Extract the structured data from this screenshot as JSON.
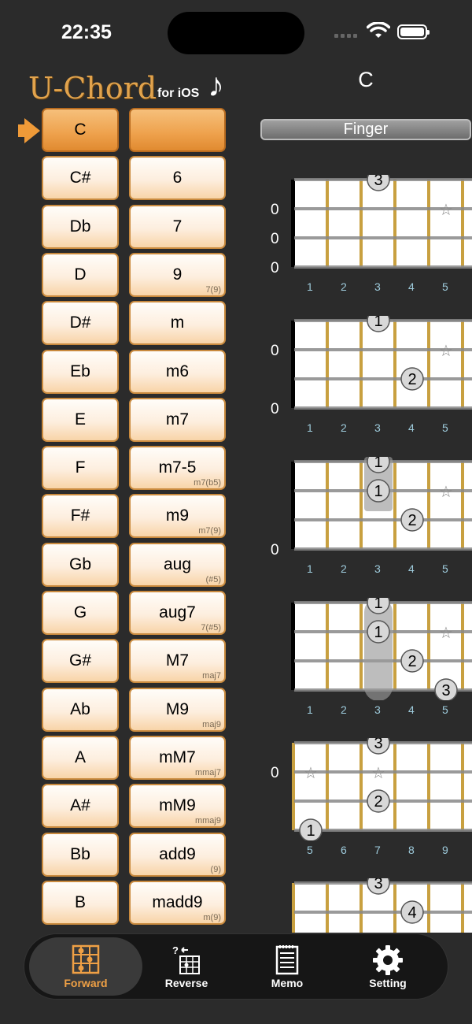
{
  "status": {
    "time": "22:35"
  },
  "logo": {
    "main": "U-Chord",
    "sub": "for iOS",
    "note": "♪"
  },
  "chord_title": "C",
  "finger_button": "Finger",
  "roots": [
    "C",
    "C#",
    "Db",
    "D",
    "D#",
    "Eb",
    "E",
    "F",
    "F#",
    "Gb",
    "G",
    "G#",
    "Ab",
    "A",
    "A#",
    "Bb",
    "B"
  ],
  "types": [
    {
      "label": "",
      "sub": ""
    },
    {
      "label": "6",
      "sub": ""
    },
    {
      "label": "7",
      "sub": ""
    },
    {
      "label": "9",
      "sub": "7(9)"
    },
    {
      "label": "m",
      "sub": ""
    },
    {
      "label": "m6",
      "sub": ""
    },
    {
      "label": "m7",
      "sub": ""
    },
    {
      "label": "m7-5",
      "sub": "m7(b5)"
    },
    {
      "label": "m9",
      "sub": "m7(9)"
    },
    {
      "label": "aug",
      "sub": "(#5)"
    },
    {
      "label": "aug7",
      "sub": "7(#5)"
    },
    {
      "label": "M7",
      "sub": "maj7"
    },
    {
      "label": "M9",
      "sub": "maj9"
    },
    {
      "label": "mM7",
      "sub": "mmaj7"
    },
    {
      "label": "mM9",
      "sub": "mmaj9"
    },
    {
      "label": "add9",
      "sub": "(9)"
    },
    {
      "label": "madd9",
      "sub": "m(9)"
    }
  ],
  "diagrams": [
    {
      "frets": [
        "1",
        "2",
        "3",
        "4",
        "5"
      ],
      "open": [
        "0",
        "0",
        "0"
      ],
      "barre": false,
      "dots": [
        {
          "s": 0,
          "f": 3,
          "label": "3"
        },
        {
          "s": 1,
          "f": 5,
          "label": "☆",
          "star": true
        }
      ]
    },
    {
      "frets": [
        "1",
        "2",
        "3",
        "4",
        "5"
      ],
      "open": [
        "0",
        "",
        "0"
      ],
      "barre": false,
      "dots": [
        {
          "s": 0,
          "f": 3,
          "label": "1"
        },
        {
          "s": 1,
          "f": 5,
          "label": "☆",
          "star": true
        },
        {
          "s": 2,
          "f": 4,
          "label": "2"
        }
      ]
    },
    {
      "frets": [
        "1",
        "2",
        "3",
        "4",
        "5"
      ],
      "open": [
        "",
        "",
        "0"
      ],
      "barre": true,
      "barre_fret": 3,
      "dots": [
        {
          "s": 0,
          "f": 3,
          "label": "1"
        },
        {
          "s": 1,
          "f": 3,
          "label": "1"
        },
        {
          "s": 1,
          "f": 5,
          "label": "☆",
          "star": true
        },
        {
          "s": 2,
          "f": 4,
          "label": "2"
        }
      ]
    },
    {
      "frets": [
        "1",
        "2",
        "3",
        "4",
        "5"
      ],
      "open": [
        "",
        "",
        ""
      ],
      "barre": true,
      "barre_fret": 3,
      "dots": [
        {
          "s": 0,
          "f": 3,
          "label": "1"
        },
        {
          "s": 1,
          "f": 3,
          "label": "1"
        },
        {
          "s": 1,
          "f": 5,
          "label": "☆",
          "star": true
        },
        {
          "s": 2,
          "f": 4,
          "label": "2"
        },
        {
          "s": 3,
          "f": 5,
          "label": "3"
        }
      ]
    },
    {
      "frets": [
        "5",
        "6",
        "7",
        "8",
        "9"
      ],
      "open": [
        "0",
        "",
        ""
      ],
      "barre": false,
      "dots": [
        {
          "s": 0,
          "f": 3,
          "label": "3"
        },
        {
          "s": 1,
          "f": 1,
          "label": "☆",
          "star": true
        },
        {
          "s": 1,
          "f": 3,
          "label": "☆",
          "star": true
        },
        {
          "s": 2,
          "f": 3,
          "label": "2"
        },
        {
          "s": 3,
          "f": 1,
          "label": "1"
        }
      ]
    },
    {
      "frets": [
        "",
        "",
        "",
        "",
        ""
      ],
      "open": [
        "",
        "",
        ""
      ],
      "barre": false,
      "dots": [
        {
          "s": 0,
          "f": 3,
          "label": "3"
        },
        {
          "s": 1,
          "f": 4,
          "label": "4"
        },
        {
          "s": 2,
          "f": 1,
          "label": "☆",
          "star": true
        },
        {
          "s": 2,
          "f": 3,
          "label": "☆",
          "star": true
        }
      ]
    }
  ],
  "tabs": [
    {
      "label": "Forward",
      "icon": "chord-grid-icon"
    },
    {
      "label": "Reverse",
      "icon": "reverse-chord-icon"
    },
    {
      "label": "Memo",
      "icon": "memo-icon"
    },
    {
      "label": "Setting",
      "icon": "gear-icon"
    }
  ],
  "colors": {
    "accent": "#efa045",
    "fret": "#c8a040",
    "background": "#2b2b2b"
  }
}
